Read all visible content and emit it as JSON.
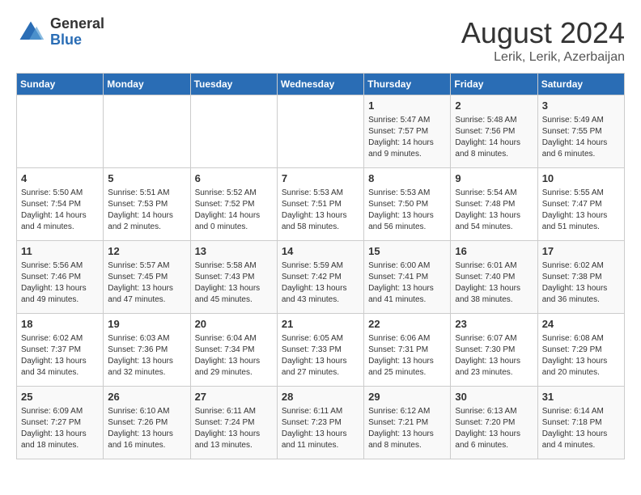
{
  "header": {
    "logo_general": "General",
    "logo_blue": "Blue",
    "month_title": "August 2024",
    "location": "Lerik, Lerik, Azerbaijan"
  },
  "weekdays": [
    "Sunday",
    "Monday",
    "Tuesday",
    "Wednesday",
    "Thursday",
    "Friday",
    "Saturday"
  ],
  "weeks": [
    [
      {
        "day": "",
        "info": ""
      },
      {
        "day": "",
        "info": ""
      },
      {
        "day": "",
        "info": ""
      },
      {
        "day": "",
        "info": ""
      },
      {
        "day": "1",
        "info": "Sunrise: 5:47 AM\nSunset: 7:57 PM\nDaylight: 14 hours\nand 9 minutes."
      },
      {
        "day": "2",
        "info": "Sunrise: 5:48 AM\nSunset: 7:56 PM\nDaylight: 14 hours\nand 8 minutes."
      },
      {
        "day": "3",
        "info": "Sunrise: 5:49 AM\nSunset: 7:55 PM\nDaylight: 14 hours\nand 6 minutes."
      }
    ],
    [
      {
        "day": "4",
        "info": "Sunrise: 5:50 AM\nSunset: 7:54 PM\nDaylight: 14 hours\nand 4 minutes."
      },
      {
        "day": "5",
        "info": "Sunrise: 5:51 AM\nSunset: 7:53 PM\nDaylight: 14 hours\nand 2 minutes."
      },
      {
        "day": "6",
        "info": "Sunrise: 5:52 AM\nSunset: 7:52 PM\nDaylight: 14 hours\nand 0 minutes."
      },
      {
        "day": "7",
        "info": "Sunrise: 5:53 AM\nSunset: 7:51 PM\nDaylight: 13 hours\nand 58 minutes."
      },
      {
        "day": "8",
        "info": "Sunrise: 5:53 AM\nSunset: 7:50 PM\nDaylight: 13 hours\nand 56 minutes."
      },
      {
        "day": "9",
        "info": "Sunrise: 5:54 AM\nSunset: 7:48 PM\nDaylight: 13 hours\nand 54 minutes."
      },
      {
        "day": "10",
        "info": "Sunrise: 5:55 AM\nSunset: 7:47 PM\nDaylight: 13 hours\nand 51 minutes."
      }
    ],
    [
      {
        "day": "11",
        "info": "Sunrise: 5:56 AM\nSunset: 7:46 PM\nDaylight: 13 hours\nand 49 minutes."
      },
      {
        "day": "12",
        "info": "Sunrise: 5:57 AM\nSunset: 7:45 PM\nDaylight: 13 hours\nand 47 minutes."
      },
      {
        "day": "13",
        "info": "Sunrise: 5:58 AM\nSunset: 7:43 PM\nDaylight: 13 hours\nand 45 minutes."
      },
      {
        "day": "14",
        "info": "Sunrise: 5:59 AM\nSunset: 7:42 PM\nDaylight: 13 hours\nand 43 minutes."
      },
      {
        "day": "15",
        "info": "Sunrise: 6:00 AM\nSunset: 7:41 PM\nDaylight: 13 hours\nand 41 minutes."
      },
      {
        "day": "16",
        "info": "Sunrise: 6:01 AM\nSunset: 7:40 PM\nDaylight: 13 hours\nand 38 minutes."
      },
      {
        "day": "17",
        "info": "Sunrise: 6:02 AM\nSunset: 7:38 PM\nDaylight: 13 hours\nand 36 minutes."
      }
    ],
    [
      {
        "day": "18",
        "info": "Sunrise: 6:02 AM\nSunset: 7:37 PM\nDaylight: 13 hours\nand 34 minutes."
      },
      {
        "day": "19",
        "info": "Sunrise: 6:03 AM\nSunset: 7:36 PM\nDaylight: 13 hours\nand 32 minutes."
      },
      {
        "day": "20",
        "info": "Sunrise: 6:04 AM\nSunset: 7:34 PM\nDaylight: 13 hours\nand 29 minutes."
      },
      {
        "day": "21",
        "info": "Sunrise: 6:05 AM\nSunset: 7:33 PM\nDaylight: 13 hours\nand 27 minutes."
      },
      {
        "day": "22",
        "info": "Sunrise: 6:06 AM\nSunset: 7:31 PM\nDaylight: 13 hours\nand 25 minutes."
      },
      {
        "day": "23",
        "info": "Sunrise: 6:07 AM\nSunset: 7:30 PM\nDaylight: 13 hours\nand 23 minutes."
      },
      {
        "day": "24",
        "info": "Sunrise: 6:08 AM\nSunset: 7:29 PM\nDaylight: 13 hours\nand 20 minutes."
      }
    ],
    [
      {
        "day": "25",
        "info": "Sunrise: 6:09 AM\nSunset: 7:27 PM\nDaylight: 13 hours\nand 18 minutes."
      },
      {
        "day": "26",
        "info": "Sunrise: 6:10 AM\nSunset: 7:26 PM\nDaylight: 13 hours\nand 16 minutes."
      },
      {
        "day": "27",
        "info": "Sunrise: 6:11 AM\nSunset: 7:24 PM\nDaylight: 13 hours\nand 13 minutes."
      },
      {
        "day": "28",
        "info": "Sunrise: 6:11 AM\nSunset: 7:23 PM\nDaylight: 13 hours\nand 11 minutes."
      },
      {
        "day": "29",
        "info": "Sunrise: 6:12 AM\nSunset: 7:21 PM\nDaylight: 13 hours\nand 8 minutes."
      },
      {
        "day": "30",
        "info": "Sunrise: 6:13 AM\nSunset: 7:20 PM\nDaylight: 13 hours\nand 6 minutes."
      },
      {
        "day": "31",
        "info": "Sunrise: 6:14 AM\nSunset: 7:18 PM\nDaylight: 13 hours\nand 4 minutes."
      }
    ]
  ]
}
